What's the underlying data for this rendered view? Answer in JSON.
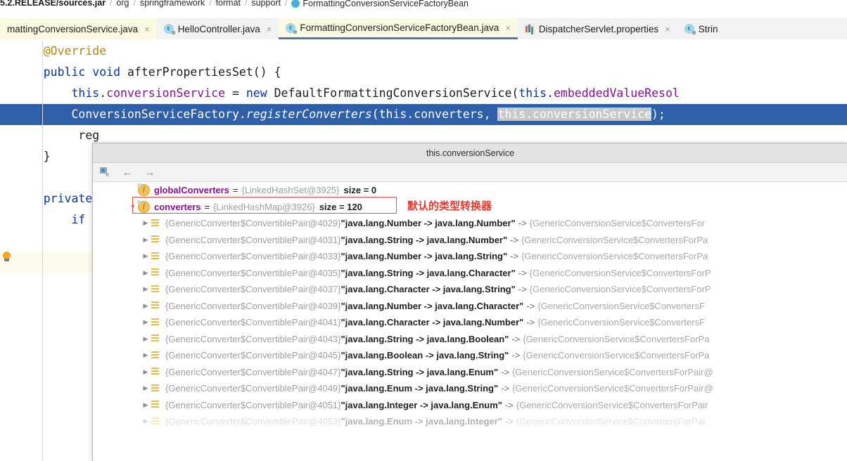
{
  "breadcrumb": {
    "items": [
      {
        "label": "5.2.RELEASE/sources.jar",
        "bold": true
      },
      {
        "label": "org"
      },
      {
        "label": "springframework"
      },
      {
        "label": "format"
      },
      {
        "label": "support"
      },
      {
        "label": "FormattingConversionServiceFactoryBean",
        "icon": "class-icon"
      }
    ],
    "separator": "/"
  },
  "tabs": [
    {
      "label": "mattingConversionService.java",
      "icon": null,
      "state": "highlight",
      "close": "×"
    },
    {
      "label": "HelloController.java",
      "icon": "class-icon",
      "state": "plain",
      "close": "×"
    },
    {
      "label": "FormattingConversionServiceFactoryBean.java",
      "icon": "class-icon",
      "state": "active",
      "close": "×"
    },
    {
      "label": "DispatcherServlet.properties",
      "icon": "properties-icon",
      "state": "plain",
      "close": "×"
    },
    {
      "label": "Strin",
      "icon": "class-icon",
      "state": "plain",
      "close": ""
    }
  ],
  "editor": {
    "lines": [
      {
        "id": "l1",
        "segments": [
          {
            "t": "    ",
            "c": "plain"
          },
          {
            "t": "@Override",
            "c": "anno"
          }
        ]
      },
      {
        "id": "l2",
        "segments": [
          {
            "t": "    ",
            "c": "plain"
          },
          {
            "t": "public",
            "c": "kw"
          },
          {
            "t": " ",
            "c": "plain"
          },
          {
            "t": "void",
            "c": "kw"
          },
          {
            "t": " afterPropertiesSet() {",
            "c": "plain"
          }
        ]
      },
      {
        "id": "l3",
        "segments": [
          {
            "t": "        ",
            "c": "plain"
          },
          {
            "t": "this",
            "c": "kw"
          },
          {
            "t": ".",
            "c": "plain"
          },
          {
            "t": "conversionService",
            "c": "fld"
          },
          {
            "t": " = ",
            "c": "plain"
          },
          {
            "t": "new",
            "c": "kw"
          },
          {
            "t": " DefaultFormattingConversionService(",
            "c": "plain"
          },
          {
            "t": "this",
            "c": "kw"
          },
          {
            "t": ".",
            "c": "plain"
          },
          {
            "t": "embeddedValueResol",
            "c": "fld"
          }
        ]
      },
      {
        "id": "l4",
        "selected": true,
        "segments": [
          {
            "t": "        ConversionServiceFactory.",
            "c": "sel-w"
          },
          {
            "t": "registerConverters",
            "c": "sel-i"
          },
          {
            "t": "(this.converters, ",
            "c": "sel-w"
          },
          {
            "t": "this.conversionService",
            "c": "sel-box"
          },
          {
            "t": ");",
            "c": "sel-w"
          }
        ]
      },
      {
        "id": "l5",
        "segments": [
          {
            "t": "         reg",
            "c": "plain"
          }
        ]
      },
      {
        "id": "l6",
        "segments": [
          {
            "t": "    }",
            "c": "plain"
          }
        ]
      },
      {
        "id": "l7",
        "segments": [
          {
            "t": "",
            "c": "plain"
          }
        ]
      },
      {
        "id": "l8",
        "segments": [
          {
            "t": "    ",
            "c": "plain"
          },
          {
            "t": "private",
            "c": "kw"
          }
        ]
      },
      {
        "id": "l9",
        "segments": [
          {
            "t": "        ",
            "c": "plain"
          },
          {
            "t": "if",
            "c": "kw"
          }
        ]
      },
      {
        "id": "l10",
        "segments": [
          {
            "t": "",
            "c": "plain"
          }
        ]
      },
      {
        "id": "l11",
        "hint": true,
        "bulb": true,
        "segments": [
          {
            "t": "",
            "c": "plain"
          }
        ]
      }
    ]
  },
  "popup": {
    "title": "this.conversionService",
    "toolbar": {
      "watch_icon": "add-to-watches-icon",
      "back_icon": "←",
      "forward_icon": "→"
    },
    "annotation": "默认的类型转换器",
    "rows": [
      {
        "depth": 1,
        "arrow": "",
        "icon": "field-icon",
        "name": "globalConverters",
        "eq": "=",
        "type": "{LinkedHashSet@3925}",
        "extra": "size = 0",
        "highlight": false
      },
      {
        "depth": 1,
        "arrow": "▼",
        "icon": "field-icon",
        "name": "converters",
        "eq": "=",
        "type": "{LinkedHashMap@3926}",
        "extra": "size = 120",
        "highlight": true
      },
      {
        "depth": 2,
        "arrow": "▶",
        "icon": "entry-icon",
        "type": "{GenericConverter$ConvertiblePair@4029}",
        "key": "\"java.lang.Number -> java.lang.Number\"",
        "arrow2": "->",
        "value": "{GenericConversionService$ConvertersFor"
      },
      {
        "depth": 2,
        "arrow": "▶",
        "icon": "entry-icon",
        "type": "{GenericConverter$ConvertiblePair@4031}",
        "key": "\"java.lang.String -> java.lang.Number\"",
        "arrow2": "->",
        "value": "{GenericConversionService$ConvertersForPa"
      },
      {
        "depth": 2,
        "arrow": "▶",
        "icon": "entry-icon",
        "type": "{GenericConverter$ConvertiblePair@4033}",
        "key": "\"java.lang.Number -> java.lang.String\"",
        "arrow2": "->",
        "value": "{GenericConversionService$ConvertersForPa"
      },
      {
        "depth": 2,
        "arrow": "▶",
        "icon": "entry-icon",
        "type": "{GenericConverter$ConvertiblePair@4035}",
        "key": "\"java.lang.String -> java.lang.Character\"",
        "arrow2": "->",
        "value": "{GenericConversionService$ConvertersForP"
      },
      {
        "depth": 2,
        "arrow": "▶",
        "icon": "entry-icon",
        "type": "{GenericConverter$ConvertiblePair@4037}",
        "key": "\"java.lang.Character -> java.lang.String\"",
        "arrow2": "->",
        "value": "{GenericConversionService$ConvertersForP"
      },
      {
        "depth": 2,
        "arrow": "▶",
        "icon": "entry-icon",
        "type": "{GenericConverter$ConvertiblePair@4039}",
        "key": "\"java.lang.Number -> java.lang.Character\"",
        "arrow2": "->",
        "value": "{GenericConversionService$ConvertersF"
      },
      {
        "depth": 2,
        "arrow": "▶",
        "icon": "entry-icon",
        "type": "{GenericConverter$ConvertiblePair@4041}",
        "key": "\"java.lang.Character -> java.lang.Number\"",
        "arrow2": "->",
        "value": "{GenericConversionService$ConvertersF"
      },
      {
        "depth": 2,
        "arrow": "▶",
        "icon": "entry-icon",
        "type": "{GenericConverter$ConvertiblePair@4043}",
        "key": "\"java.lang.String -> java.lang.Boolean\"",
        "arrow2": "->",
        "value": "{GenericConversionService$ConvertersForPa"
      },
      {
        "depth": 2,
        "arrow": "▶",
        "icon": "entry-icon",
        "type": "{GenericConverter$ConvertiblePair@4045}",
        "key": "\"java.lang.Boolean -> java.lang.String\"",
        "arrow2": "->",
        "value": "{GenericConversionService$ConvertersForPa"
      },
      {
        "depth": 2,
        "arrow": "▶",
        "icon": "entry-icon",
        "type": "{GenericConverter$ConvertiblePair@4047}",
        "key": "\"java.lang.String -> java.lang.Enum\"",
        "arrow2": "->",
        "value": "{GenericConversionService$ConvertersForPair@"
      },
      {
        "depth": 2,
        "arrow": "▶",
        "icon": "entry-icon",
        "type": "{GenericConverter$ConvertiblePair@4049}",
        "key": "\"java.lang.Enum -> java.lang.String\"",
        "arrow2": "->",
        "value": "{GenericConversionService$ConvertersForPair@"
      },
      {
        "depth": 2,
        "arrow": "▶",
        "icon": "entry-icon",
        "type": "{GenericConverter$ConvertiblePair@4051}",
        "key": "\"java.lang.Integer -> java.lang.Enum\"",
        "arrow2": "->",
        "value": "{GenericConversionService$ConvertersForPair"
      },
      {
        "depth": 2,
        "arrow": "▶",
        "icon": "entry-icon",
        "type": "{GenericConverter$ConvertiblePair@4053}",
        "key": "\"java.lang.Enum -> java.lang.Integer\"",
        "arrow2": "->",
        "value": "{GenericConversionService$ConvertersForPai",
        "clipped": true
      }
    ]
  },
  "colors": {
    "selection_blue": "#2f5fa8",
    "tab_active_bg": "#fbf8e3",
    "annotation_red": "#e03c31",
    "field_name_purple": "#871094",
    "keyword_blue": "#0033b3"
  }
}
